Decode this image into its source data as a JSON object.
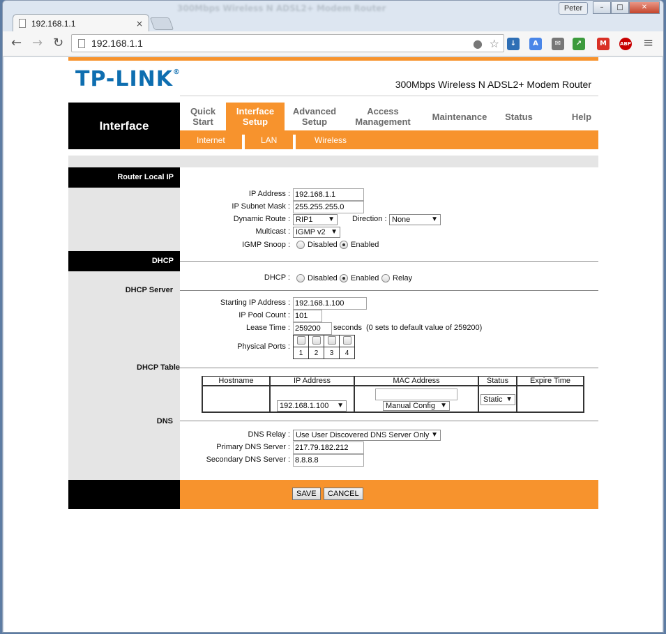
{
  "browser": {
    "bg_tab_title": "300Mbps Wireless N ADSL2+ Modem Router",
    "tab_title": "192.168.1.1",
    "tab_close": "×",
    "user": "Peter",
    "url": "192.168.1.1",
    "win_minimize": "–",
    "win_maximize": "□",
    "win_close": "✕",
    "back": "←",
    "forward": "→",
    "reload": "↻",
    "menu": "≡",
    "ext_labels": {
      "abp": "ABP",
      "gmail": "M",
      "translate": "A"
    }
  },
  "header": {
    "logo": "TP-LINK",
    "logo_mark": "®",
    "model": "300Mbps Wireless N ADSL2+ Modem Router",
    "section": "Interface"
  },
  "menu": {
    "quick_start": [
      "Quick",
      "Start"
    ],
    "interface_setup": [
      "Interface",
      "Setup"
    ],
    "advanced_setup": [
      "Advanced",
      "Setup"
    ],
    "access_management": [
      "Access",
      "Management"
    ],
    "maintenance": "Maintenance",
    "status": "Status",
    "help": "Help"
  },
  "submenu": {
    "internet": "Internet",
    "lan": "LAN",
    "wireless": "Wireless"
  },
  "router_ip": {
    "heading": "Router Local IP",
    "ip_label": "IP Address :",
    "ip_value": "192.168.1.1",
    "mask_label": "IP Subnet Mask :",
    "mask_value": "255.255.255.0",
    "route_label": "Dynamic Route :",
    "route_value": "RIP1",
    "direction_label": "Direction :",
    "direction_value": "None",
    "multicast_label": "Multicast :",
    "multicast_value": "IGMP v2",
    "igmp_label": "IGMP Snoop :",
    "igmp_disabled": "Disabled",
    "igmp_enabled": "Enabled"
  },
  "dhcp": {
    "heading": "DHCP",
    "dhcp_label": "DHCP :",
    "opt_disabled": "Disabled",
    "opt_enabled": "Enabled",
    "opt_relay": "Relay",
    "server_heading": "DHCP Server",
    "start_label": "Starting IP Address :",
    "start_value": "192.168.1.100",
    "pool_label": "IP Pool Count :",
    "pool_value": "101",
    "lease_label": "Lease Time :",
    "lease_value": "259200",
    "lease_unit": "seconds",
    "lease_note": "(0 sets to default value of 259200)",
    "ports_label": "Physical Ports :",
    "ports": [
      "1",
      "2",
      "3",
      "4"
    ]
  },
  "dhcp_table": {
    "heading": "DHCP Table",
    "columns": [
      "Hostname",
      "IP Address",
      "MAC Address",
      "Status",
      "Expire Time"
    ],
    "row": {
      "ip_select": "192.168.1.100",
      "mac_value": "",
      "mac_select": "Manual Config",
      "status_select": "Static"
    }
  },
  "dns": {
    "heading": "DNS",
    "relay_label": "DNS Relay :",
    "relay_value": "Use User Discovered DNS Server Only",
    "primary_label": "Primary DNS Server :",
    "primary_value": "217.79.182.212",
    "secondary_label": "Secondary DNS Server :",
    "secondary_value": "8.8.8.8"
  },
  "actions": {
    "save": "SAVE",
    "cancel": "CANCEL"
  },
  "colors": {
    "brand_orange": "#f7932d",
    "logo_blue": "#0e6eb0"
  }
}
